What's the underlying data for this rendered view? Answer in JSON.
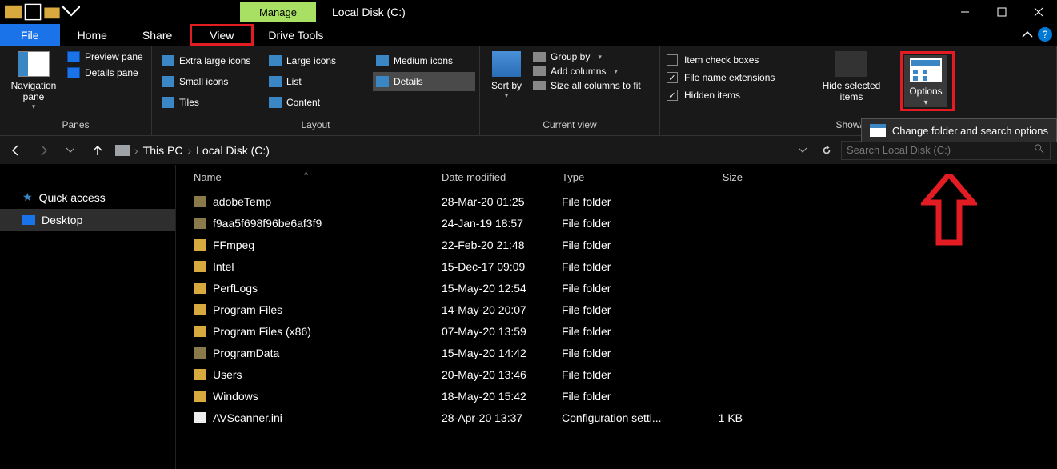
{
  "titlebar": {
    "manage": "Manage",
    "title": "Local Disk (C:)"
  },
  "tabs": {
    "file": "File",
    "home": "Home",
    "share": "Share",
    "view": "View",
    "drive": "Drive Tools"
  },
  "ribbon": {
    "panes": {
      "nav": "Navigation pane",
      "preview": "Preview pane",
      "details": "Details pane",
      "group": "Panes"
    },
    "layout": {
      "xl": "Extra large icons",
      "lg": "Large icons",
      "md": "Medium icons",
      "sm": "Small icons",
      "list": "List",
      "details": "Details",
      "tiles": "Tiles",
      "content": "Content",
      "group": "Layout"
    },
    "curview": {
      "sort": "Sort by",
      "group_by": "Group by",
      "add_cols": "Add columns",
      "size_cols": "Size all columns to fit",
      "group": "Current view"
    },
    "showhide": {
      "item_chk": "Item check boxes",
      "ext": "File name extensions",
      "hidden": "Hidden items",
      "hide_sel": "Hide selected items",
      "options": "Options",
      "group": "Show/hide"
    },
    "popup": "Change folder and search options"
  },
  "addr": {
    "thispc": "This PC",
    "loc": "Local Disk (C:)",
    "search_ph": "Search Local Disk (C:)"
  },
  "tree": {
    "quick": "Quick access",
    "desktop": "Desktop"
  },
  "columns": {
    "name": "Name",
    "date": "Date modified",
    "type": "Type",
    "size": "Size"
  },
  "rows": [
    {
      "name": "adobeTemp",
      "date": "28-Mar-20 01:25",
      "type": "File folder",
      "size": "",
      "icon": "dim"
    },
    {
      "name": "f9aa5f698f96be6af3f9",
      "date": "24-Jan-19 18:57",
      "type": "File folder",
      "size": "",
      "icon": "dim"
    },
    {
      "name": "FFmpeg",
      "date": "22-Feb-20 21:48",
      "type": "File folder",
      "size": "",
      "icon": "folder"
    },
    {
      "name": "Intel",
      "date": "15-Dec-17 09:09",
      "type": "File folder",
      "size": "",
      "icon": "folder"
    },
    {
      "name": "PerfLogs",
      "date": "15-May-20 12:54",
      "type": "File folder",
      "size": "",
      "icon": "folder"
    },
    {
      "name": "Program Files",
      "date": "14-May-20 20:07",
      "type": "File folder",
      "size": "",
      "icon": "folder"
    },
    {
      "name": "Program Files (x86)",
      "date": "07-May-20 13:59",
      "type": "File folder",
      "size": "",
      "icon": "folder"
    },
    {
      "name": "ProgramData",
      "date": "15-May-20 14:42",
      "type": "File folder",
      "size": "",
      "icon": "dim"
    },
    {
      "name": "Users",
      "date": "20-May-20 13:46",
      "type": "File folder",
      "size": "",
      "icon": "folder"
    },
    {
      "name": "Windows",
      "date": "18-May-20 15:42",
      "type": "File folder",
      "size": "",
      "icon": "folder"
    },
    {
      "name": "AVScanner.ini",
      "date": "28-Apr-20 13:37",
      "type": "Configuration setti...",
      "size": "1 KB",
      "icon": "file"
    }
  ]
}
